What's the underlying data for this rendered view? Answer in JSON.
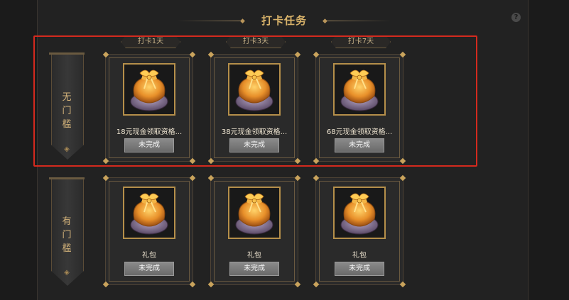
{
  "header": {
    "title": "打卡任务",
    "help_icon": "question-icon"
  },
  "day_tags": [
    "打卡1天",
    "打卡3天",
    "打卡7天"
  ],
  "rows": [
    {
      "banner": "无门槛",
      "cards": [
        {
          "label": "18元现金领取资格...",
          "status": "未完成",
          "icon": "gift-bag-icon"
        },
        {
          "label": "38元现金领取资格...",
          "status": "未完成",
          "icon": "gift-bag-icon"
        },
        {
          "label": "68元现金领取资格...",
          "status": "未完成",
          "icon": "gift-bag-icon"
        }
      ]
    },
    {
      "banner": "有门槛",
      "cards": [
        {
          "label": "礼包",
          "status": "未完成",
          "icon": "gift-bag-icon"
        },
        {
          "label": "礼包",
          "status": "未完成",
          "icon": "gift-bag-icon"
        },
        {
          "label": "礼包",
          "status": "未完成",
          "icon": "gift-bag-icon"
        }
      ]
    }
  ],
  "colors": {
    "accent": "#d9b36a",
    "highlight": "#d42a1e",
    "background": "#222222"
  }
}
